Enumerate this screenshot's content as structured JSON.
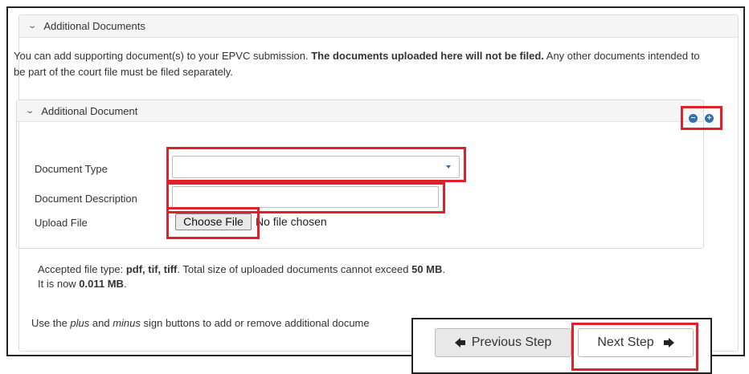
{
  "section": {
    "title": "Additional Documents",
    "intro_prefix": "You can add supporting document(s) to your EPVC submission. ",
    "intro_bold": "The documents uploaded here will not be filed.",
    "intro_suffix": " Any other documents intended to be part of the court file must be filed separately."
  },
  "subsection": {
    "title": "Additional Document",
    "minus_symbol": "−",
    "plus_symbol": "+"
  },
  "form": {
    "document_type_label": "Document Type",
    "document_type_value": "",
    "document_description_label": "Document Description",
    "document_description_value": "",
    "upload_file_label": "Upload File",
    "choose_file_label": "Choose File",
    "file_status": "No file chosen"
  },
  "note": {
    "accepted_prefix": "Accepted file type: ",
    "accepted_types": "pdf, tif, tiff",
    "accepted_suffix": ". Total size of uploaded documents cannot exceed ",
    "max_size": "50 MB",
    "period": ".",
    "current_prefix": "It is now ",
    "current_size": "0.011 MB",
    "current_suffix": "."
  },
  "usage": {
    "text1": "Use the ",
    "plus_word": "plus",
    "text2": " and ",
    "minus_word": "minus",
    "text3": " sign buttons to add or remove additional docume"
  },
  "nav": {
    "previous_label": "Previous Step",
    "next_label": "Next Step"
  },
  "colors": {
    "highlight": "#e0212b",
    "accent": "#2f6fb5"
  }
}
